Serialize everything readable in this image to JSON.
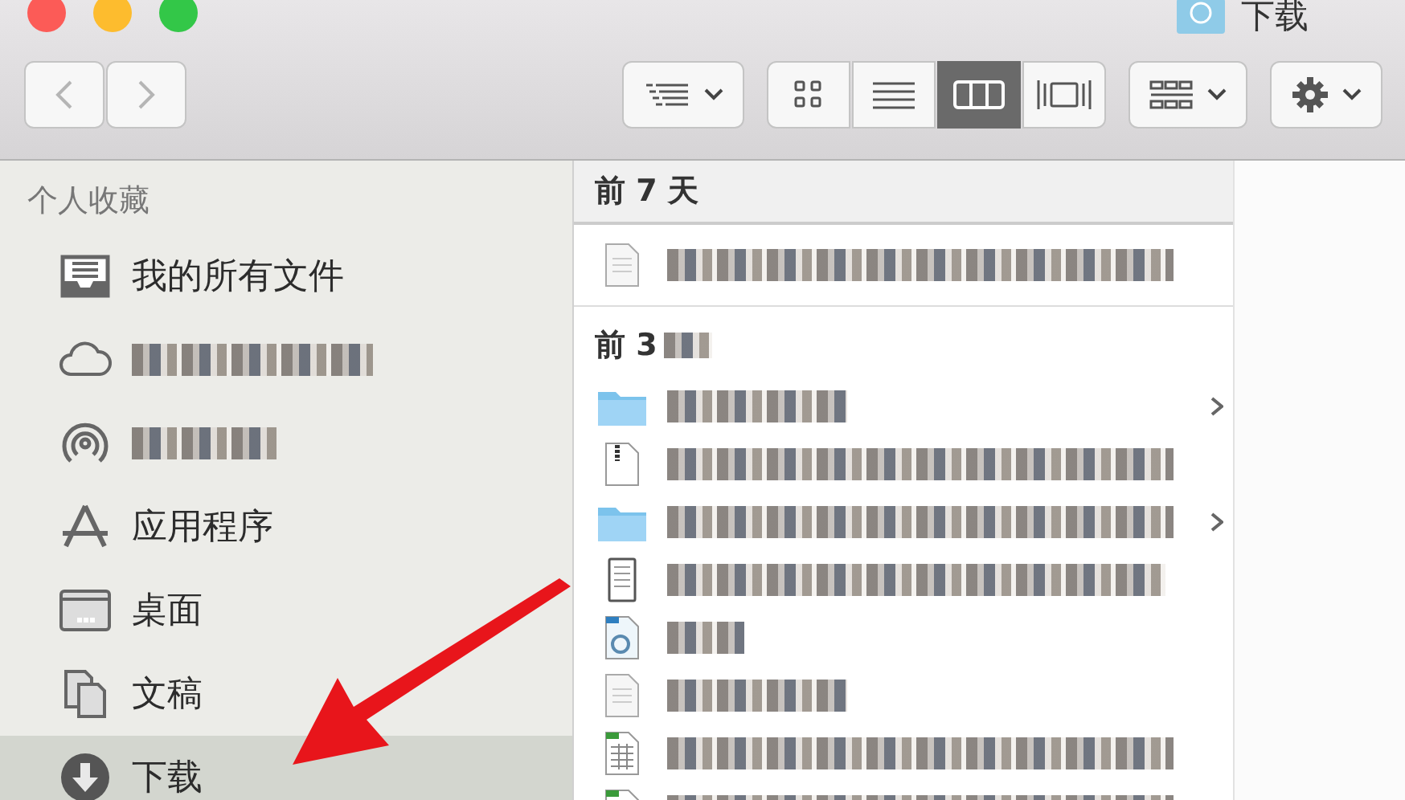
{
  "window": {
    "title": "下载"
  },
  "toolbar": {
    "view_modes": [
      {
        "kind": "icons",
        "selected": false
      },
      {
        "kind": "list",
        "selected": false
      },
      {
        "kind": "columns",
        "selected": true
      },
      {
        "kind": "coverflow",
        "selected": false
      }
    ]
  },
  "sidebar": {
    "heading": "个人收藏",
    "items": [
      {
        "kind": "all-files",
        "label": "我的所有文件",
        "selected": false
      },
      {
        "kind": "cloud",
        "selected": false
      },
      {
        "kind": "airdrop",
        "selected": false
      },
      {
        "kind": "apps",
        "label": "应用程序",
        "selected": false
      },
      {
        "kind": "desktop",
        "label": "桌面",
        "selected": false
      },
      {
        "kind": "documents",
        "label": "文稿",
        "selected": false
      },
      {
        "kind": "downloads",
        "label": "下载",
        "selected": true
      }
    ]
  },
  "sections": [
    {
      "heading": "前 7 天",
      "files": [
        {
          "kind": "document"
        }
      ]
    },
    {
      "heading": "前 3",
      "files": [
        {
          "kind": "folder"
        },
        {
          "kind": "archive"
        },
        {
          "kind": "folder"
        },
        {
          "kind": "ebook"
        },
        {
          "kind": "text"
        },
        {
          "kind": "document"
        },
        {
          "kind": "spreadsheet"
        },
        {
          "kind": "spreadsheet"
        }
      ]
    }
  ]
}
